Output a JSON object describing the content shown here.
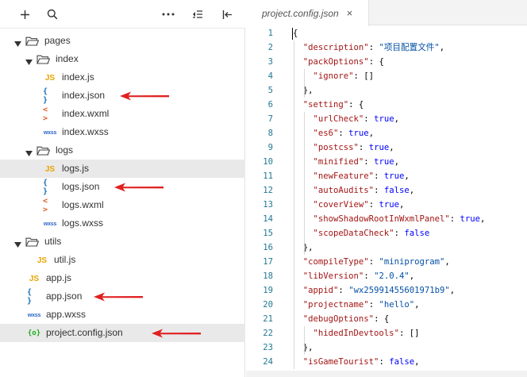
{
  "sidebar": {
    "toolbar": {
      "add_icon": "plus-icon",
      "search_icon": "search-icon",
      "more_icon": "more-icon",
      "collapse_icon": "collapse-all-icon",
      "panel_icon": "panel-toggle-icon"
    },
    "tree": [
      {
        "label": "pages",
        "type": "folder",
        "depth": 0,
        "selected": false
      },
      {
        "label": "index",
        "type": "folder",
        "depth": 1,
        "selected": false
      },
      {
        "label": "index.js",
        "type": "js",
        "depth": 2,
        "selected": false
      },
      {
        "label": "index.json",
        "type": "json",
        "depth": 2,
        "selected": false,
        "arrow": true
      },
      {
        "label": "index.wxml",
        "type": "wxml",
        "depth": 2,
        "selected": false
      },
      {
        "label": "index.wxss",
        "type": "wxss",
        "depth": 2,
        "selected": false
      },
      {
        "label": "logs",
        "type": "folder",
        "depth": 1,
        "selected": false
      },
      {
        "label": "logs.js",
        "type": "js",
        "depth": 2,
        "selected": true
      },
      {
        "label": "logs.json",
        "type": "json",
        "depth": 2,
        "selected": false,
        "arrow": true
      },
      {
        "label": "logs.wxml",
        "type": "wxml",
        "depth": 2,
        "selected": false
      },
      {
        "label": "logs.wxss",
        "type": "wxss",
        "depth": 2,
        "selected": false
      },
      {
        "label": "utils",
        "type": "folder",
        "depth": 0,
        "selected": false
      },
      {
        "label": "util.js",
        "type": "js",
        "depth": 1,
        "selected": false
      },
      {
        "label": "app.js",
        "type": "js",
        "depth": 0,
        "selected": false
      },
      {
        "label": "app.json",
        "type": "json",
        "depth": 0,
        "selected": false,
        "arrow": true
      },
      {
        "label": "app.wxss",
        "type": "wxss",
        "depth": 0,
        "selected": false
      },
      {
        "label": "project.config.json",
        "type": "config",
        "depth": 0,
        "selected": true,
        "arrow": true
      }
    ],
    "icon_text": {
      "js": "JS",
      "json": "{ }",
      "wxml": "< >",
      "wxss": "wxss",
      "config": "{o}"
    }
  },
  "editor": {
    "tab_title": "project.config.json",
    "tab_close": "×",
    "lines": [
      {
        "n": "1",
        "tokens": [
          [
            "p",
            "{"
          ]
        ]
      },
      {
        "n": "2",
        "tokens": [
          [
            "p",
            "  "
          ],
          [
            "k",
            "\"description\""
          ],
          [
            "p",
            ": "
          ],
          [
            "s",
            "\"项目配置文件\""
          ],
          [
            "p",
            ","
          ]
        ]
      },
      {
        "n": "3",
        "tokens": [
          [
            "p",
            "  "
          ],
          [
            "k",
            "\"packOptions\""
          ],
          [
            "p",
            ": {"
          ]
        ]
      },
      {
        "n": "4",
        "tokens": [
          [
            "p",
            "    "
          ],
          [
            "k",
            "\"ignore\""
          ],
          [
            "p",
            ": []"
          ]
        ]
      },
      {
        "n": "5",
        "tokens": [
          [
            "p",
            "  },"
          ]
        ]
      },
      {
        "n": "6",
        "tokens": [
          [
            "p",
            "  "
          ],
          [
            "k",
            "\"setting\""
          ],
          [
            "p",
            ": {"
          ]
        ]
      },
      {
        "n": "7",
        "tokens": [
          [
            "p",
            "    "
          ],
          [
            "k",
            "\"urlCheck\""
          ],
          [
            "p",
            ": "
          ],
          [
            "b",
            "true"
          ],
          [
            "p",
            ","
          ]
        ]
      },
      {
        "n": "8",
        "tokens": [
          [
            "p",
            "    "
          ],
          [
            "k",
            "\"es6\""
          ],
          [
            "p",
            ": "
          ],
          [
            "b",
            "true"
          ],
          [
            "p",
            ","
          ]
        ]
      },
      {
        "n": "9",
        "tokens": [
          [
            "p",
            "    "
          ],
          [
            "k",
            "\"postcss\""
          ],
          [
            "p",
            ": "
          ],
          [
            "b",
            "true"
          ],
          [
            "p",
            ","
          ]
        ]
      },
      {
        "n": "10",
        "tokens": [
          [
            "p",
            "    "
          ],
          [
            "k",
            "\"minified\""
          ],
          [
            "p",
            ": "
          ],
          [
            "b",
            "true"
          ],
          [
            "p",
            ","
          ]
        ]
      },
      {
        "n": "11",
        "tokens": [
          [
            "p",
            "    "
          ],
          [
            "k",
            "\"newFeature\""
          ],
          [
            "p",
            ": "
          ],
          [
            "b",
            "true"
          ],
          [
            "p",
            ","
          ]
        ]
      },
      {
        "n": "12",
        "tokens": [
          [
            "p",
            "    "
          ],
          [
            "k",
            "\"autoAudits\""
          ],
          [
            "p",
            ": "
          ],
          [
            "b",
            "false"
          ],
          [
            "p",
            ","
          ]
        ]
      },
      {
        "n": "13",
        "tokens": [
          [
            "p",
            "    "
          ],
          [
            "k",
            "\"coverView\""
          ],
          [
            "p",
            ": "
          ],
          [
            "b",
            "true"
          ],
          [
            "p",
            ","
          ]
        ]
      },
      {
        "n": "14",
        "tokens": [
          [
            "p",
            "    "
          ],
          [
            "k",
            "\"showShadowRootInWxmlPanel\""
          ],
          [
            "p",
            ": "
          ],
          [
            "b",
            "true"
          ],
          [
            "p",
            ","
          ]
        ]
      },
      {
        "n": "15",
        "tokens": [
          [
            "p",
            "    "
          ],
          [
            "k",
            "\"scopeDataCheck\""
          ],
          [
            "p",
            ": "
          ],
          [
            "b",
            "false"
          ]
        ]
      },
      {
        "n": "16",
        "tokens": [
          [
            "p",
            "  },"
          ]
        ]
      },
      {
        "n": "17",
        "tokens": [
          [
            "p",
            "  "
          ],
          [
            "k",
            "\"compileType\""
          ],
          [
            "p",
            ": "
          ],
          [
            "s",
            "\"miniprogram\""
          ],
          [
            "p",
            ","
          ]
        ]
      },
      {
        "n": "18",
        "tokens": [
          [
            "p",
            "  "
          ],
          [
            "k",
            "\"libVersion\""
          ],
          [
            "p",
            ": "
          ],
          [
            "s",
            "\"2.0.4\""
          ],
          [
            "p",
            ","
          ]
        ]
      },
      {
        "n": "19",
        "tokens": [
          [
            "p",
            "  "
          ],
          [
            "k",
            "\"appid\""
          ],
          [
            "p",
            ": "
          ],
          [
            "s",
            "\"wx25991455601971b9\""
          ],
          [
            "p",
            ","
          ]
        ]
      },
      {
        "n": "20",
        "tokens": [
          [
            "p",
            "  "
          ],
          [
            "k",
            "\"projectname\""
          ],
          [
            "p",
            ": "
          ],
          [
            "s",
            "\"hello\""
          ],
          [
            "p",
            ","
          ]
        ]
      },
      {
        "n": "21",
        "tokens": [
          [
            "p",
            "  "
          ],
          [
            "k",
            "\"debugOptions\""
          ],
          [
            "p",
            ": {"
          ]
        ]
      },
      {
        "n": "22",
        "tokens": [
          [
            "p",
            "    "
          ],
          [
            "k",
            "\"hidedInDevtools\""
          ],
          [
            "p",
            ": []"
          ]
        ]
      },
      {
        "n": "23",
        "tokens": [
          [
            "p",
            "  },"
          ]
        ]
      },
      {
        "n": "24",
        "tokens": [
          [
            "p",
            "  "
          ],
          [
            "k",
            "\"isGameTourist\""
          ],
          [
            "p",
            ": "
          ],
          [
            "b",
            "false"
          ],
          [
            "p",
            ","
          ]
        ]
      }
    ]
  },
  "colors": {
    "annotation_arrow": "#e02020",
    "selected_row": "#e9e9e9",
    "line_number": "#237893"
  }
}
